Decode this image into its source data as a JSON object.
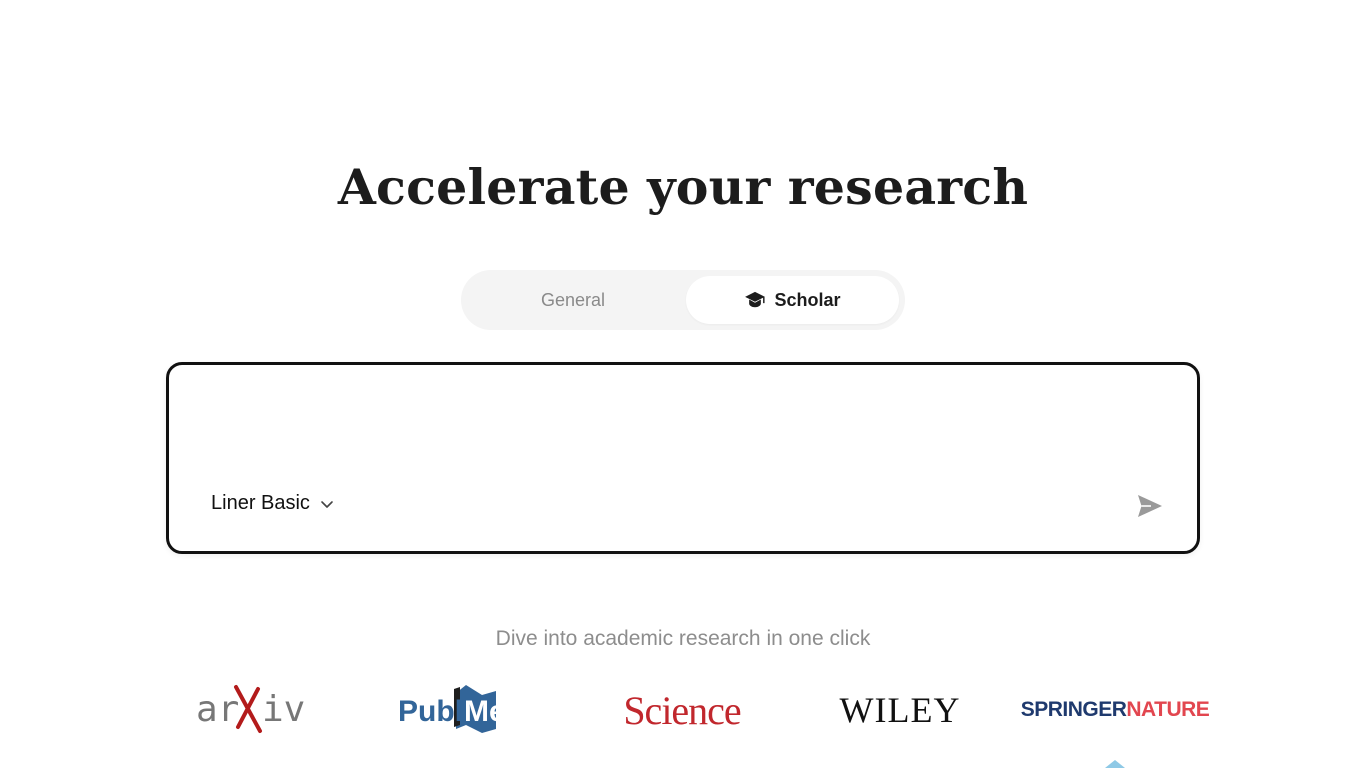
{
  "hero": {
    "title": "Accelerate your research"
  },
  "mode_toggle": {
    "tabs": [
      {
        "label": "General",
        "selected": false
      },
      {
        "label": "Scholar",
        "selected": true,
        "icon": "graduation-cap-icon"
      }
    ]
  },
  "query": {
    "input_value": "",
    "input_placeholder": "",
    "model_label": "Liner Basic",
    "model_icon": "chevron-down-icon",
    "send_icon": "send-icon"
  },
  "sources": {
    "tagline": "Dive into academic research in one click",
    "logos": [
      {
        "name": "arXiv",
        "text_a": "ar",
        "text_b": "iv",
        "x_color": "#b31b1b"
      },
      {
        "name": "PubMed",
        "text_a": "Publ",
        "text_b": "Med",
        "color": "#326599"
      },
      {
        "name": "Science",
        "text": "Science",
        "color": "#c1272d"
      },
      {
        "name": "Wiley",
        "text": "WILEY",
        "color": "#111111"
      },
      {
        "name": "Springer Nature",
        "text_a": "SPRINGER",
        "text_b": "NATURE",
        "color_a": "#1f3a6e",
        "color_b": "#e2464f"
      }
    ]
  },
  "colors": {
    "accent_border": "#111111",
    "toggle_bg": "#f4f4f4",
    "muted_text": "#8d8d8d"
  }
}
